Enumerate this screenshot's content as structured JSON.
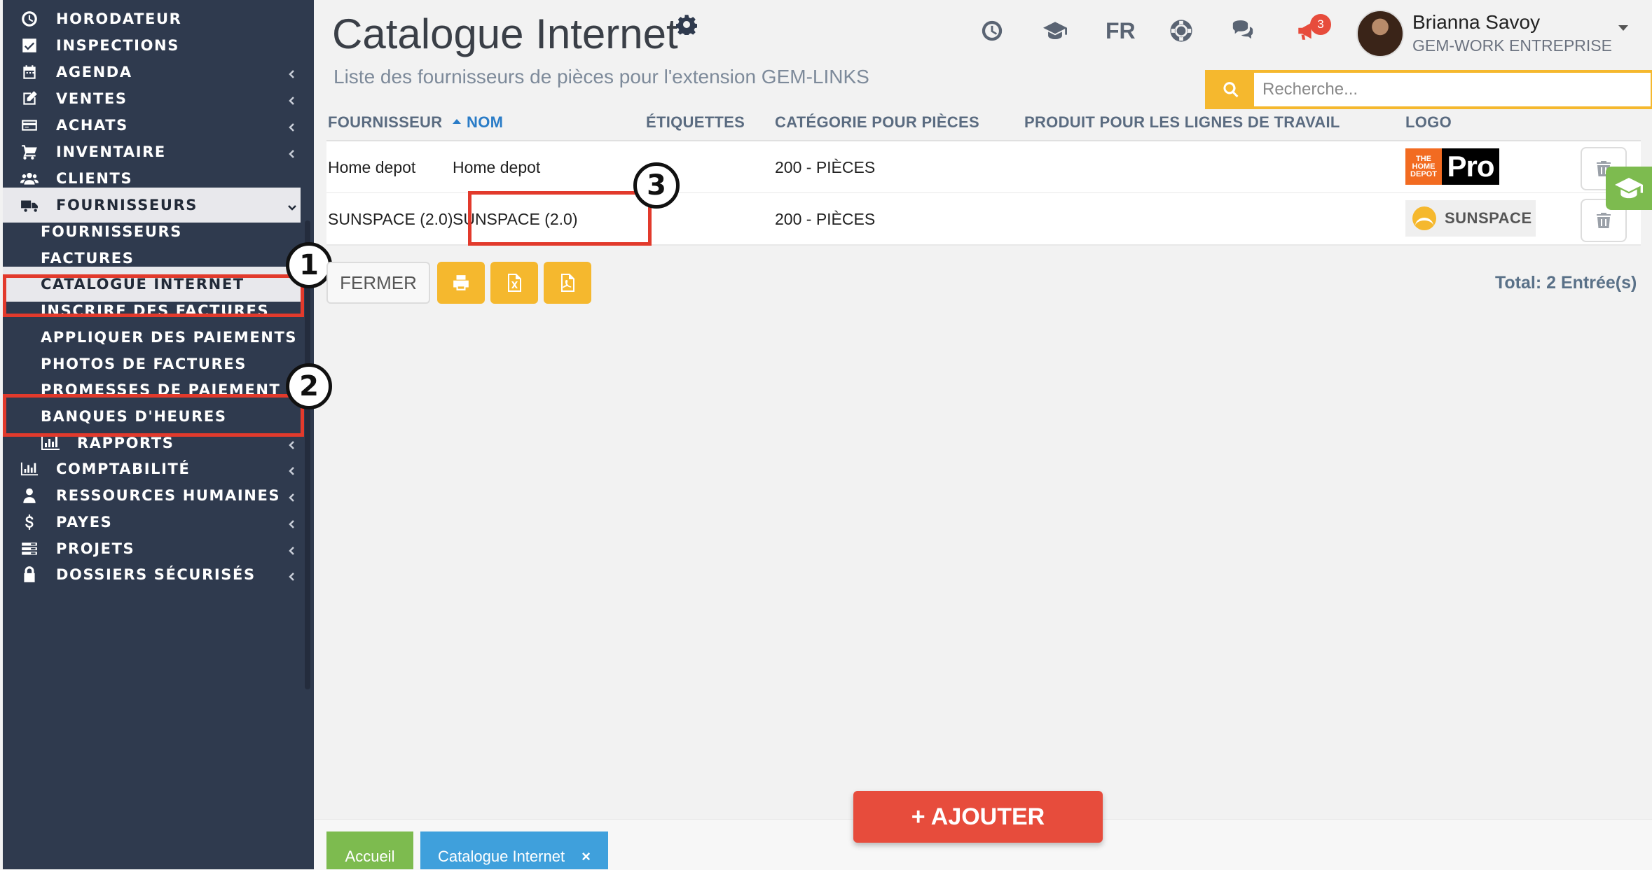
{
  "sidebar": {
    "items": [
      {
        "label": "HORODATEUR",
        "icon": "clock-icon",
        "chevron": false
      },
      {
        "label": "INSPECTIONS",
        "icon": "checkbox-icon",
        "chevron": false
      },
      {
        "label": "AGENDA",
        "icon": "calendar-icon",
        "chevron": true
      },
      {
        "label": "VENTES",
        "icon": "edit-icon",
        "chevron": true
      },
      {
        "label": "ACHATS",
        "icon": "credit-card-icon",
        "chevron": true
      },
      {
        "label": "INVENTAIRE",
        "icon": "cart-icon",
        "chevron": true
      },
      {
        "label": "CLIENTS",
        "icon": "users-icon",
        "chevron": false
      },
      {
        "label": "FOURNISSEURS",
        "icon": "truck-icon",
        "chevron": true,
        "expanded": true
      }
    ],
    "sub_items": [
      {
        "label": "FOURNISSEURS"
      },
      {
        "label": "FACTURES"
      },
      {
        "label": "CATALOGUE INTERNET",
        "active": true
      },
      {
        "label": "INSCRIRE DES FACTURES"
      },
      {
        "label": "APPLIQUER DES PAIEMENTS"
      },
      {
        "label": "PHOTOS DE FACTURES"
      },
      {
        "label": "PROMESSES DE PAIEMENT"
      },
      {
        "label": "BANQUES D'HEURES"
      },
      {
        "label": "RAPPORTS",
        "icon": "bar-chart-icon"
      }
    ],
    "bottom_items": [
      {
        "label": "COMPTABILITÉ",
        "icon": "bar-chart-icon"
      },
      {
        "label": "RESSOURCES HUMAINES",
        "icon": "user-icon"
      },
      {
        "label": "PAYES",
        "icon": "dollar-icon"
      },
      {
        "label": "PROJETS",
        "icon": "list-icon"
      },
      {
        "label": "DOSSIERS SÉCURISÉS",
        "icon": "lock-icon"
      }
    ]
  },
  "callouts": [
    "1",
    "2",
    "3"
  ],
  "header": {
    "title": "Catalogue Internet",
    "subtitle": "Liste des fournisseurs de pièces pour l'extension GEM-LINKS",
    "lang": "FR",
    "notification_count": "3",
    "user_name": "Brianna Savoy",
    "user_company": "GEM-WORK ENTREPRISE"
  },
  "search": {
    "placeholder": "Recherche..."
  },
  "table": {
    "columns": [
      "FOURNISSEUR",
      "NOM",
      "ÉTIQUETTES",
      "CATÉGORIE POUR PIÈCES",
      "PRODUIT POUR LES LIGNES DE TRAVAIL",
      "LOGO"
    ],
    "sorted_column": "NOM",
    "rows": [
      {
        "fournisseur": "Home depot",
        "nom": "Home depot",
        "etiquettes": "",
        "categorie": "200 - PIÈCES",
        "produit": "",
        "logo": "homedepot-pro"
      },
      {
        "fournisseur": "SUNSPACE (2.0)",
        "nom": "SUNSPACE (2.0)",
        "etiquettes": "",
        "categorie": "200 - PIÈCES",
        "produit": "",
        "logo": "sunspace"
      }
    ]
  },
  "logos": {
    "homedepot_pro_text": "Pro",
    "homedepot_small_text": "THE HOME DEPOT",
    "sunspace_text": "SUNSPACE"
  },
  "toolbar": {
    "close_label": "FERMER",
    "total": "Total: 2 Entrée(s)"
  },
  "footer": {
    "add_label": "+ AJOUTER",
    "tabs": [
      {
        "label": "Accueil"
      },
      {
        "label": "Catalogue Internet"
      }
    ],
    "tab_close": "×"
  },
  "colors": {
    "sidebar_bg": "#2f3a4e",
    "accent_yellow": "#f5b82e",
    "danger_red": "#e74c3c",
    "highlight_box": "#e23a2c",
    "green": "#7dbb4f",
    "blue": "#3fa0dc"
  }
}
